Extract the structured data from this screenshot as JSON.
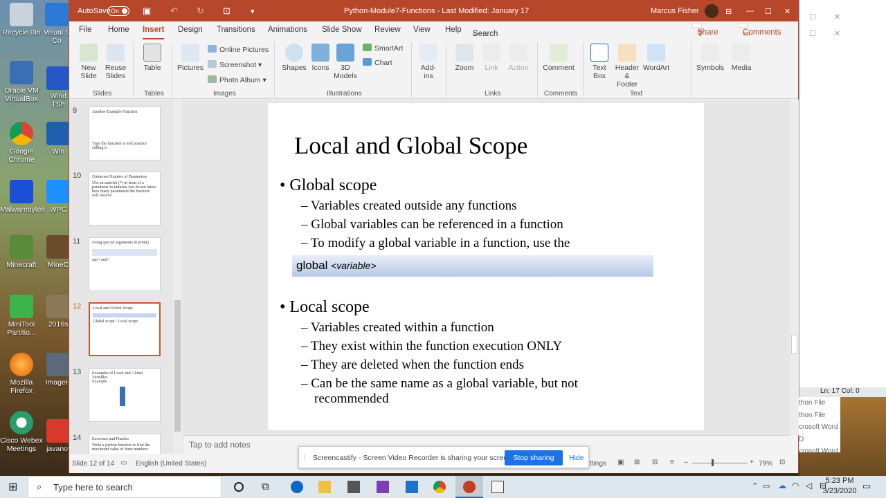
{
  "desktop": {
    "icons": [
      "Recycle Bin",
      "Visual S Co",
      "Oracle VM VirtualBox",
      "Wind TSh",
      "Google Chrome",
      "Win",
      "Malwarebytes",
      "WPC",
      "Minecraft",
      "MineC",
      "MiniTool Partitio...",
      "2016s",
      "Mozilla Firefox",
      "ImageH",
      "Cisco Webex Meetings",
      "javanot"
    ]
  },
  "titlebar": {
    "autosave": "AutoSave",
    "autosave_state": "On",
    "doc_title": "Python-Module7-Functions - Last Modified: January 17",
    "user": "Marcus Fisher"
  },
  "tabs": [
    "File",
    "Home",
    "Insert",
    "Design",
    "Transitions",
    "Animations",
    "Slide Show",
    "Review",
    "View",
    "Help",
    "Search"
  ],
  "actions": {
    "share": "Share",
    "comments": "Comments"
  },
  "ribbon": {
    "new_slide": "New Slide",
    "reuse_slides": "Reuse Slides",
    "table": "Table",
    "pictures": "Pictures",
    "online_pictures": "Online Pictures",
    "screenshot": "Screenshot",
    "photo_album": "Photo Album",
    "shapes": "Shapes",
    "icons": "Icons",
    "models": "3D Models",
    "smartart": "SmartArt",
    "chart": "Chart",
    "addins": "Add-ins",
    "zoom": "Zoom",
    "link": "Link",
    "action": "Action",
    "comment": "Comment",
    "textbox": "Text Box",
    "header_footer": "Header & Footer",
    "wordart": "WordArt",
    "symbols": "Symbols",
    "media": "Media",
    "groups": [
      "Slides",
      "Tables",
      "Images",
      "Illustrations",
      "Links",
      "Comments",
      "Text"
    ]
  },
  "thumbnails": [
    {
      "num": "9",
      "title": "Another Example Function",
      "body": "Type the function in and practice calling it"
    },
    {
      "num": "10",
      "title": "Unknown Number of Parameters",
      "body": "Use an asterisk (*) in front of a parameter to indicate you do not know how many parameters the function will receive"
    },
    {
      "num": "11",
      "title": "Using special arguments in print()",
      "body": "sep= end="
    },
    {
      "num": "12",
      "title": "Local and Global Scope",
      "body": "Global scope / Local scope"
    },
    {
      "num": "13",
      "title": "Examples of Local and Global Variables",
      "body": "Example"
    },
    {
      "num": "14",
      "title": "Exercises and Puzzles",
      "body": "Write a python function to find the maximum value of three numbers"
    }
  ],
  "slide": {
    "title": "Local and Global Scope",
    "global_heading": "Global scope",
    "global_items": [
      "Variables created outside any functions",
      "Global variables can be referenced in a function",
      "To modify a global variable in a function, use the"
    ],
    "code_keyword": "global",
    "code_arg": "<variable>",
    "local_heading": "Local scope",
    "local_items": [
      "Variables created within a function",
      "They exist within the function execution ONLY",
      "They are deleted when the function ends",
      "Can be the same name as a global variable, but not recommended"
    ]
  },
  "notes": "Tap to add notes",
  "status": {
    "slide": "Slide 12 of 14",
    "language": "English (United States)",
    "settings": "ttings",
    "zoom": "79%"
  },
  "sharebar": {
    "message": "Screencastify - Screen Video Recorder is sharing your screen.",
    "stop": "Stop sharing",
    "hide": "Hide"
  },
  "sidewin": {
    "lncol": "Ln: 17 Col: 0",
    "items": [
      "thon File",
      "thon File",
      "crosoft Word D",
      "crosoft Word D",
      "crosoft Word D"
    ]
  },
  "taskbar": {
    "search": "Type here to search",
    "time": "5:23 PM",
    "date": "3/23/2020"
  }
}
